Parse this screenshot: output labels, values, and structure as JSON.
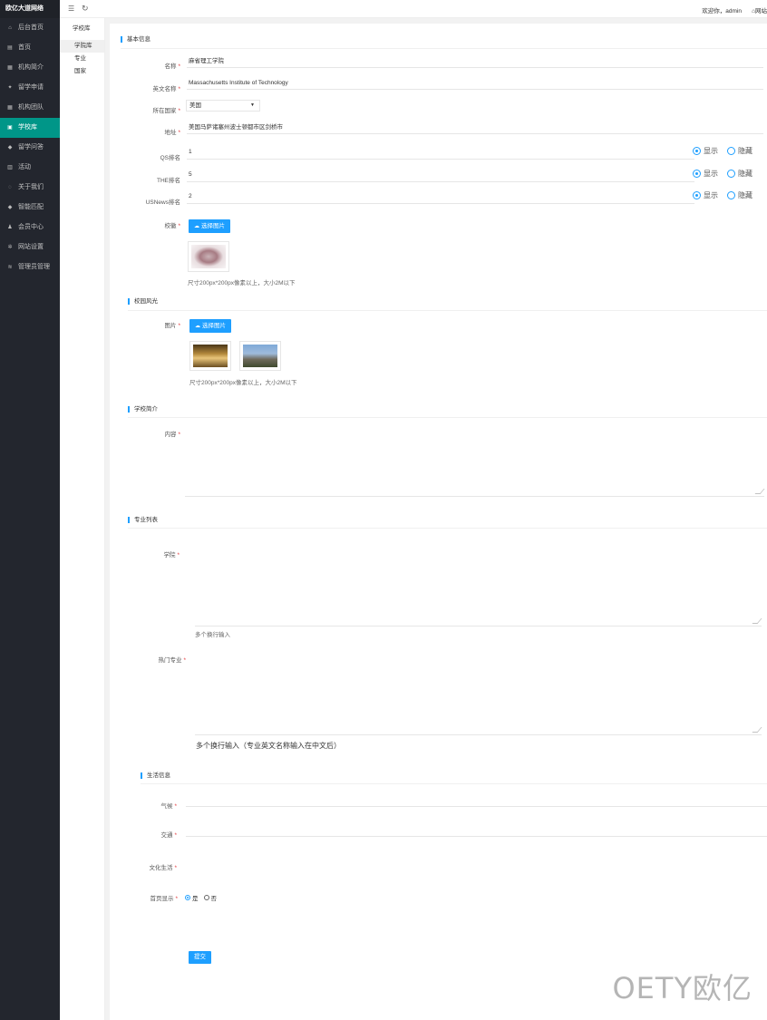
{
  "sidebar": {
    "brand": "欧亿大道网络",
    "items": [
      {
        "icon": "home-icon",
        "glyph": "⌂",
        "label": "后台首页"
      },
      {
        "icon": "doc-icon",
        "glyph": "▤",
        "label": "首页"
      },
      {
        "icon": "building-icon",
        "glyph": "▦",
        "label": "机构简介"
      },
      {
        "icon": "star-icon",
        "glyph": "✦",
        "label": "留学申请"
      },
      {
        "icon": "building-icon",
        "glyph": "▦",
        "label": "机构团队"
      },
      {
        "icon": "library-icon",
        "glyph": "▣",
        "label": "学校库",
        "active": true
      },
      {
        "icon": "tag-icon",
        "glyph": "◆",
        "label": "留学问答"
      },
      {
        "icon": "calendar-icon",
        "glyph": "▥",
        "label": "活动"
      },
      {
        "icon": "chat-icon",
        "glyph": "◌",
        "label": "关于我们"
      },
      {
        "icon": "tag-icon",
        "glyph": "◆",
        "label": "智能匹配"
      },
      {
        "icon": "user-icon",
        "glyph": "♟",
        "label": "会员中心"
      },
      {
        "icon": "gear-icon",
        "glyph": "✲",
        "label": "网站设置"
      },
      {
        "icon": "layers-icon",
        "glyph": "≋",
        "label": "管理员管理"
      }
    ]
  },
  "topbar": {
    "menu_glyph": "☰",
    "refresh_glyph": "↻",
    "greeting": "欢迎你，admin",
    "home_label": "网站"
  },
  "subnav": {
    "head": "学校库",
    "items": [
      {
        "label": "学院库",
        "active": true
      },
      {
        "label": "专业"
      },
      {
        "label": "国家"
      }
    ]
  },
  "sections": {
    "basic": "基本信息",
    "scenery": "校园风光",
    "intro": "学校简介",
    "majors": "专业列表",
    "living": "生活信息"
  },
  "form": {
    "name_label": "名称",
    "name_value": "麻省理工学院",
    "en_label": "英文名称",
    "en_value": "Massachusetts Institute of Technology",
    "country_label": "所在国家",
    "country_value": "美国",
    "address_label": "地址",
    "address_value": "美国马萨诸塞州波士顿都市区剑桥市",
    "qs_label": "QS排名",
    "qs_value": "1",
    "the_label": "THE排名",
    "the_value": "5",
    "usnews_label": "USNews排名",
    "usnews_value": "2",
    "show_label": "显示",
    "hide_label": "隐藏",
    "badge_label": "校徽",
    "choose_image": "选择图片",
    "badge_hint": "尺寸200px*200px像素以上，大小2M以下",
    "photos_label": "图片",
    "photos_hint": "尺寸200px*200px像素以上，大小2M以下",
    "content_label": "内容",
    "subject_label": "学院",
    "subject_hint": "多个换行输入",
    "hot_label": "热门专业",
    "hot_hint": "多个换行输入（专业英文名称输入在中文后）",
    "climate_label": "气候",
    "traffic_label": "交通",
    "culture_label": "文化生活",
    "home_show_label": "首页显示",
    "yes_label": "是",
    "no_label": "否",
    "submit_label": "提交"
  },
  "watermark": "OETY欧亿"
}
